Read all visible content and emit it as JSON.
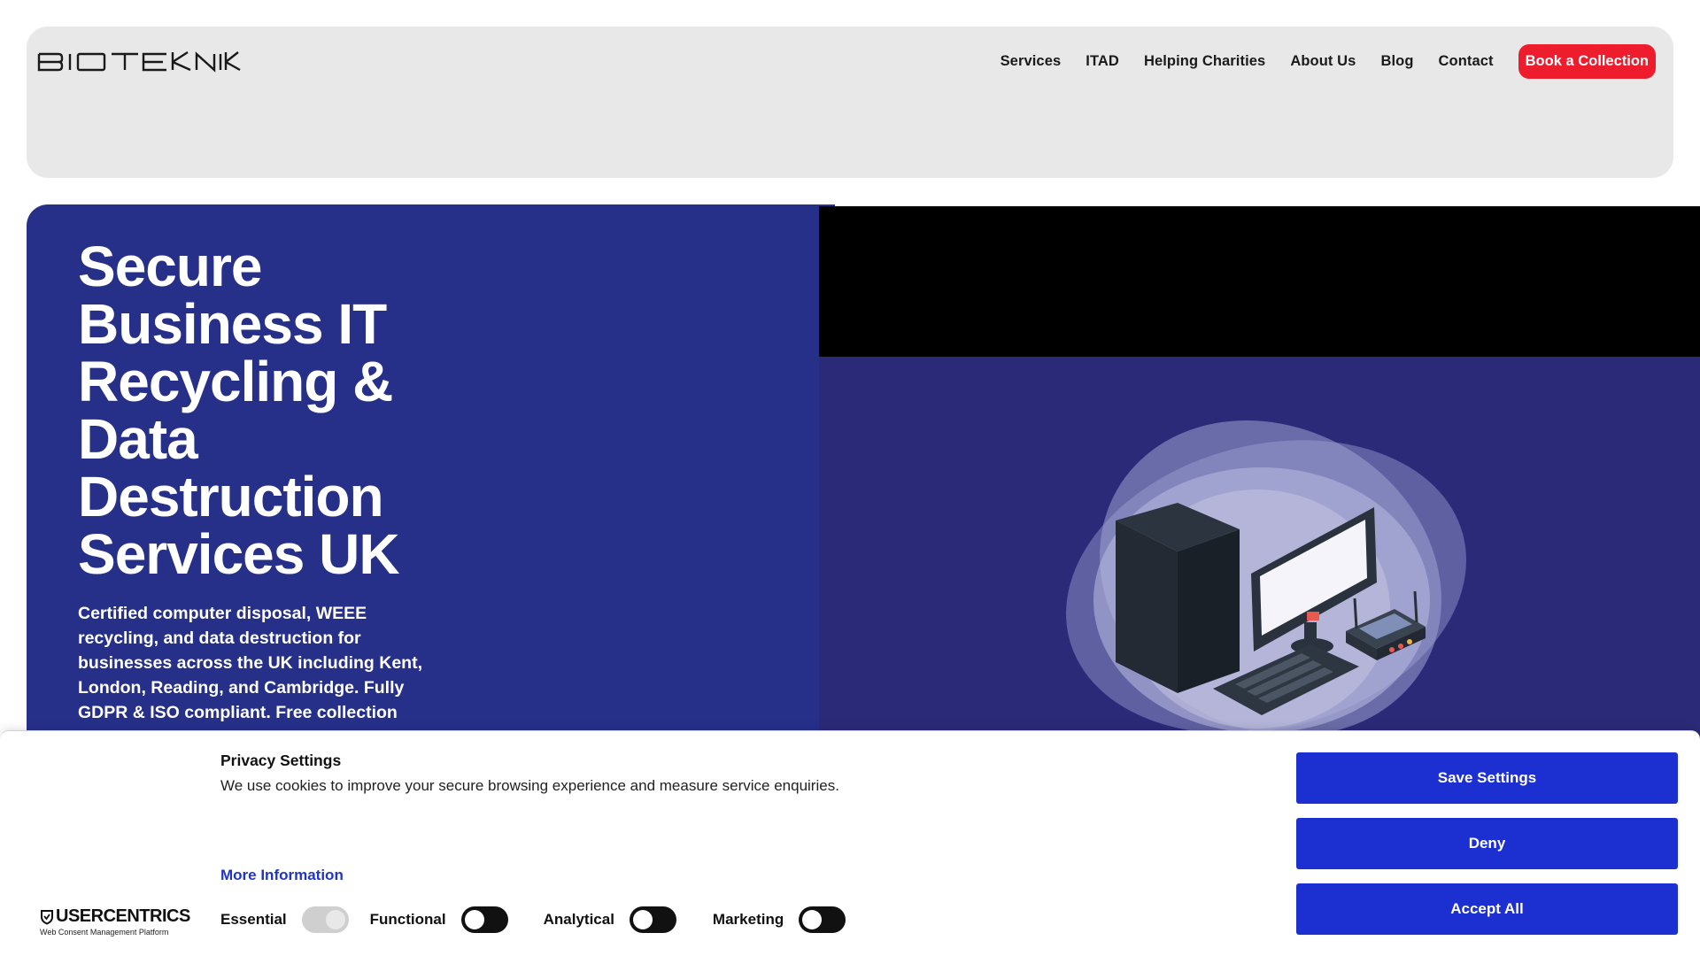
{
  "header": {
    "logo_text": "BIOTEKNIK",
    "nav": [
      "Services",
      "ITAD",
      "Helping Charities",
      "About Us",
      "Blog",
      "Contact"
    ],
    "cta": "Book a Collection"
  },
  "hero": {
    "title": "Secure Business IT Recycling & Data Destruction Services UK",
    "subtitle": "Certified computer disposal, WEEE recycling, and data destruction for businesses across the UK including Kent, London, Reading, and Cambridge. Fully GDPR & ISO compliant. Free collection"
  },
  "cookie_banner": {
    "title": "Privacy Settings",
    "description": "We use cookies to improve your secure browsing experience and measure service enquiries.",
    "more_info": "More Information",
    "brand": "USERCENTRICS",
    "brand_tagline": "Web Consent Management Platform",
    "toggles": [
      {
        "label": "Essential",
        "enabled": true,
        "locked": true
      },
      {
        "label": "Functional",
        "enabled": false,
        "locked": false
      },
      {
        "label": "Analytical",
        "enabled": false,
        "locked": false
      },
      {
        "label": "Marketing",
        "enabled": false,
        "locked": false
      }
    ],
    "buttons": {
      "save": "Save Settings",
      "deny": "Deny",
      "accept": "Accept All"
    }
  },
  "colors": {
    "hero_blue": "#263089",
    "illustration_bg": "#2b2a79",
    "cta_red": "#ee1d2d",
    "button_blue": "#1c2fd0"
  }
}
